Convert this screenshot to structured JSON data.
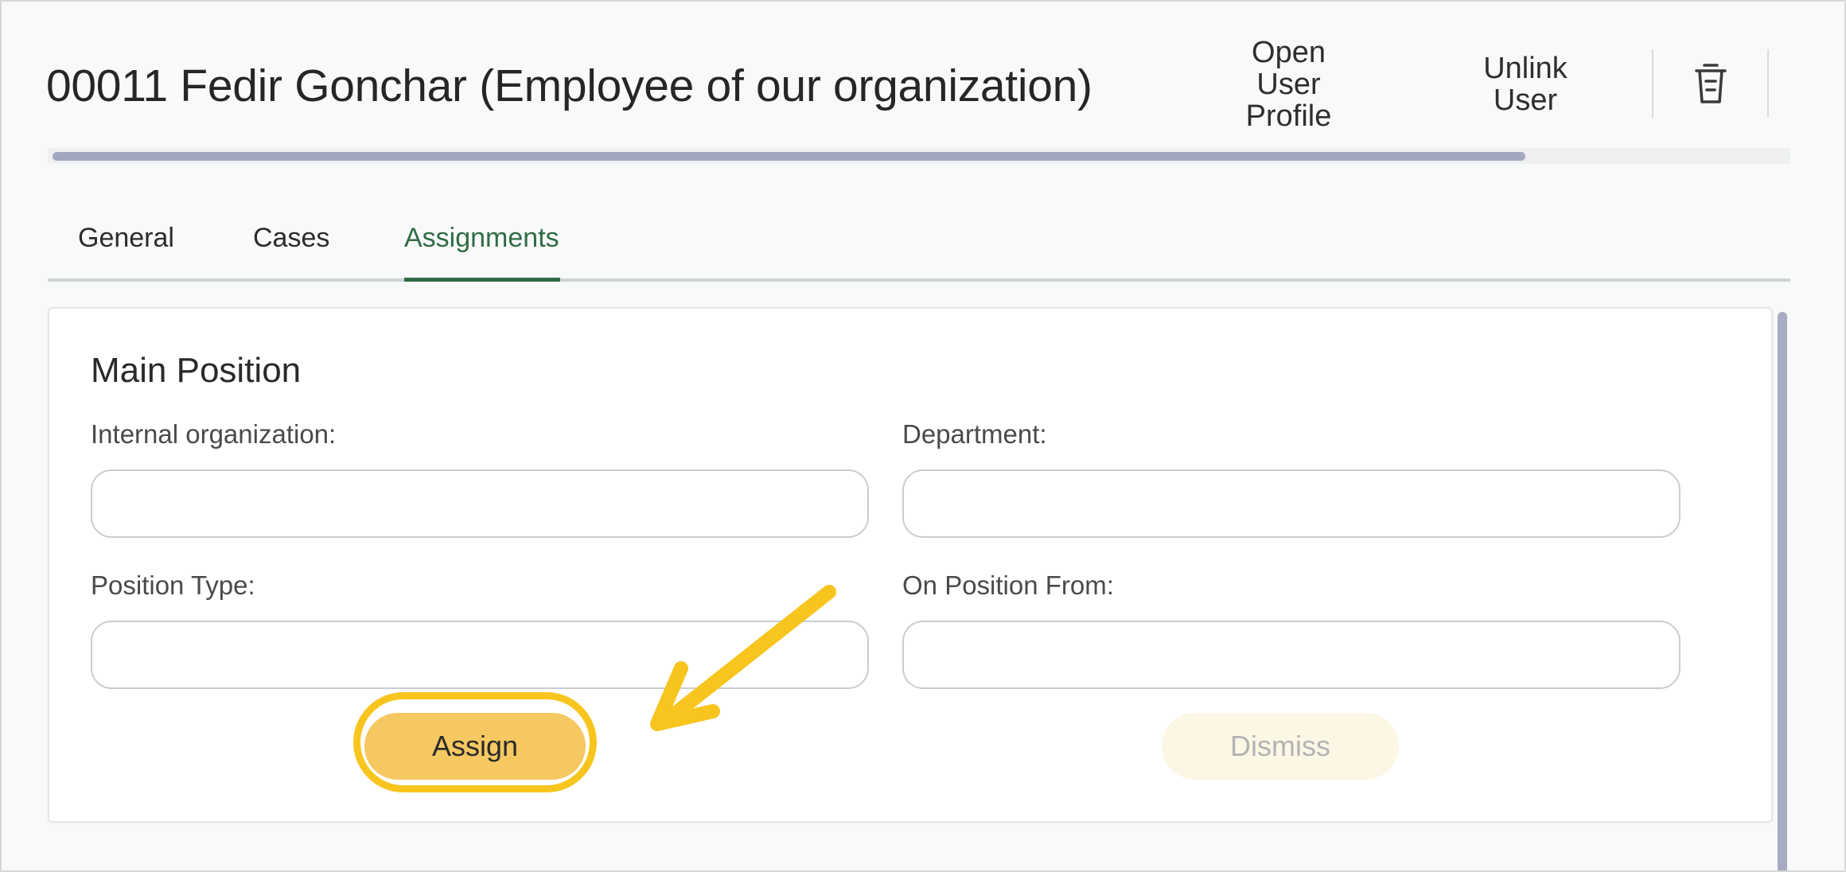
{
  "header": {
    "title": "00011 Fedir Gonchar (Employee of our organization)",
    "open_profile_label": "Open\nUser\nProfile",
    "unlink_label": "Unlink\nUser",
    "delete_icon": "trash-icon"
  },
  "progress": {
    "value_percent": 85
  },
  "tabs": [
    {
      "label": "General",
      "active": false
    },
    {
      "label": "Cases",
      "active": false
    },
    {
      "label": "Assignments",
      "active": true
    }
  ],
  "main_position": {
    "title": "Main Position",
    "fields": {
      "internal_organization": {
        "label": "Internal organization:",
        "value": ""
      },
      "department": {
        "label": "Department:",
        "value": ""
      },
      "position_type": {
        "label": "Position Type:",
        "value": ""
      },
      "on_position_from": {
        "label": "On Position From:",
        "value": ""
      }
    },
    "assign_label": "Assign",
    "dismiss_label": "Dismiss"
  },
  "colors": {
    "accent_green": "#2f6b44",
    "assign_bg": "#f6c861",
    "highlight": "#f8c51f",
    "dismiss_bg": "#fcf7e4",
    "progress_fill": "#a3a8c0"
  }
}
